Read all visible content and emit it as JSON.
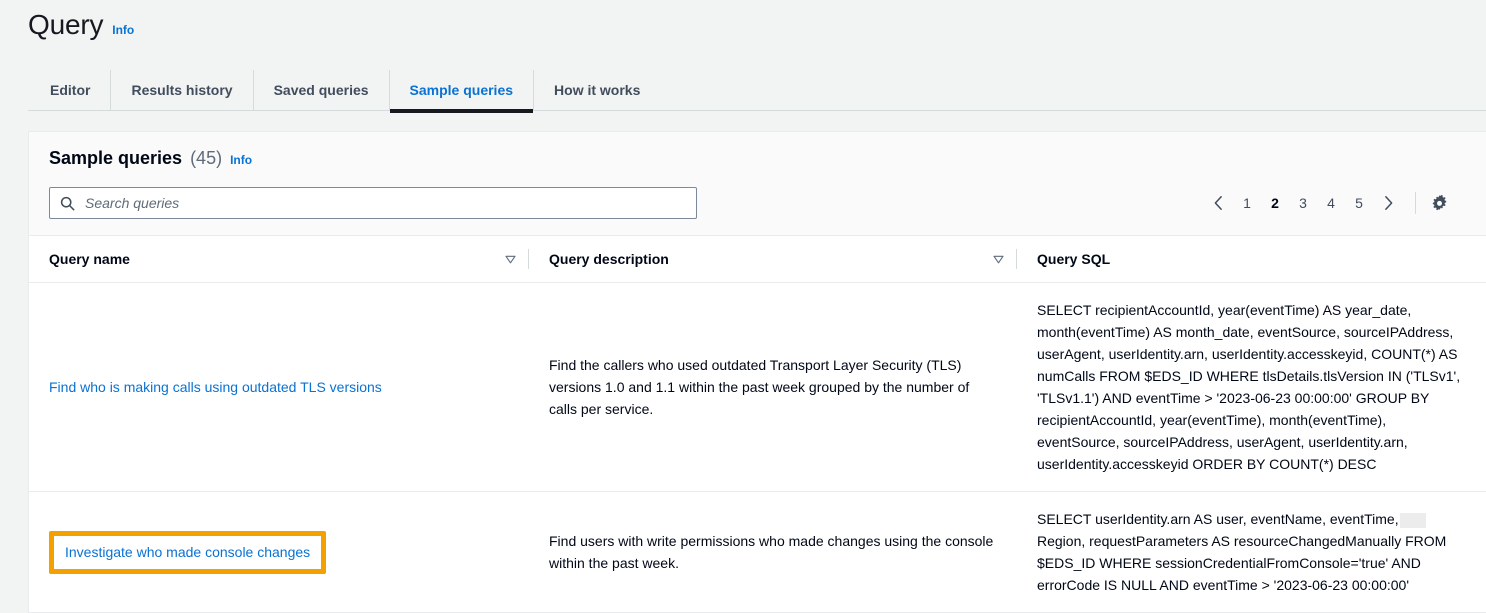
{
  "header": {
    "title": "Query",
    "info_label": "Info"
  },
  "tabs": [
    {
      "label": "Editor",
      "active": false
    },
    {
      "label": "Results history",
      "active": false
    },
    {
      "label": "Saved queries",
      "active": false
    },
    {
      "label": "Sample queries",
      "active": true
    },
    {
      "label": "How it works",
      "active": false
    }
  ],
  "panel": {
    "title": "Sample queries",
    "count": "(45)",
    "info_label": "Info",
    "search": {
      "placeholder": "Search queries",
      "value": "",
      "icon": "search-icon"
    },
    "pagination": {
      "prev_icon": "chevron-left-icon",
      "next_icon": "chevron-right-icon",
      "pages": [
        "1",
        "2",
        "3",
        "4",
        "5"
      ],
      "current": "2",
      "settings_icon": "gear-icon"
    }
  },
  "table": {
    "columns": [
      {
        "label": "Query name",
        "sort_icon": "sort-descending-icon"
      },
      {
        "label": "Query description",
        "sort_icon": "sort-descending-icon"
      },
      {
        "label": "Query SQL",
        "sort_icon": ""
      }
    ],
    "rows": [
      {
        "name": "Find who is making calls using outdated TLS versions",
        "description": "Find the callers who used outdated Transport Layer Security (TLS) versions 1.0 and 1.1 within the past week grouped by the number of calls per service.",
        "sql": "SELECT recipientAccountId, year(eventTime) AS year_date, month(eventTime) AS month_date, eventSource, sourceIPAddress, userAgent, userIdentity.arn, userIdentity.accesskeyid, COUNT(*) AS numCalls FROM $EDS_ID WHERE tlsDetails.tlsVersion IN ('TLSv1', 'TLSv1.1') AND eventTime > '2023-06-23 00:00:00' GROUP BY recipientAccountId, year(eventTime), month(eventTime), eventSource, sourceIPAddress, userAgent, userIdentity.arn, userIdentity.accesskeyid ORDER BY COUNT(*) DESC",
        "focused": false
      },
      {
        "name": "Investigate who made console changes",
        "description": "Find users with write permissions who made changes using the console within the past week.",
        "sql_before": "SELECT userIdentity.arn AS user, eventName, eventTime,",
        "sql_after": "Region, requestParameters AS resourceChangedManually FROM $EDS_ID WHERE sessionCredentialFromConsole='true' AND errorCode IS NULL AND eventTime > '2023-06-23 00:00:00'",
        "focused": true
      }
    ]
  },
  "colors": {
    "link": "#0972d3",
    "focus_ring": "#f2a100",
    "page_background": "#f2f3f3",
    "panel_header": "#fafafa",
    "border": "#e9ebed"
  }
}
